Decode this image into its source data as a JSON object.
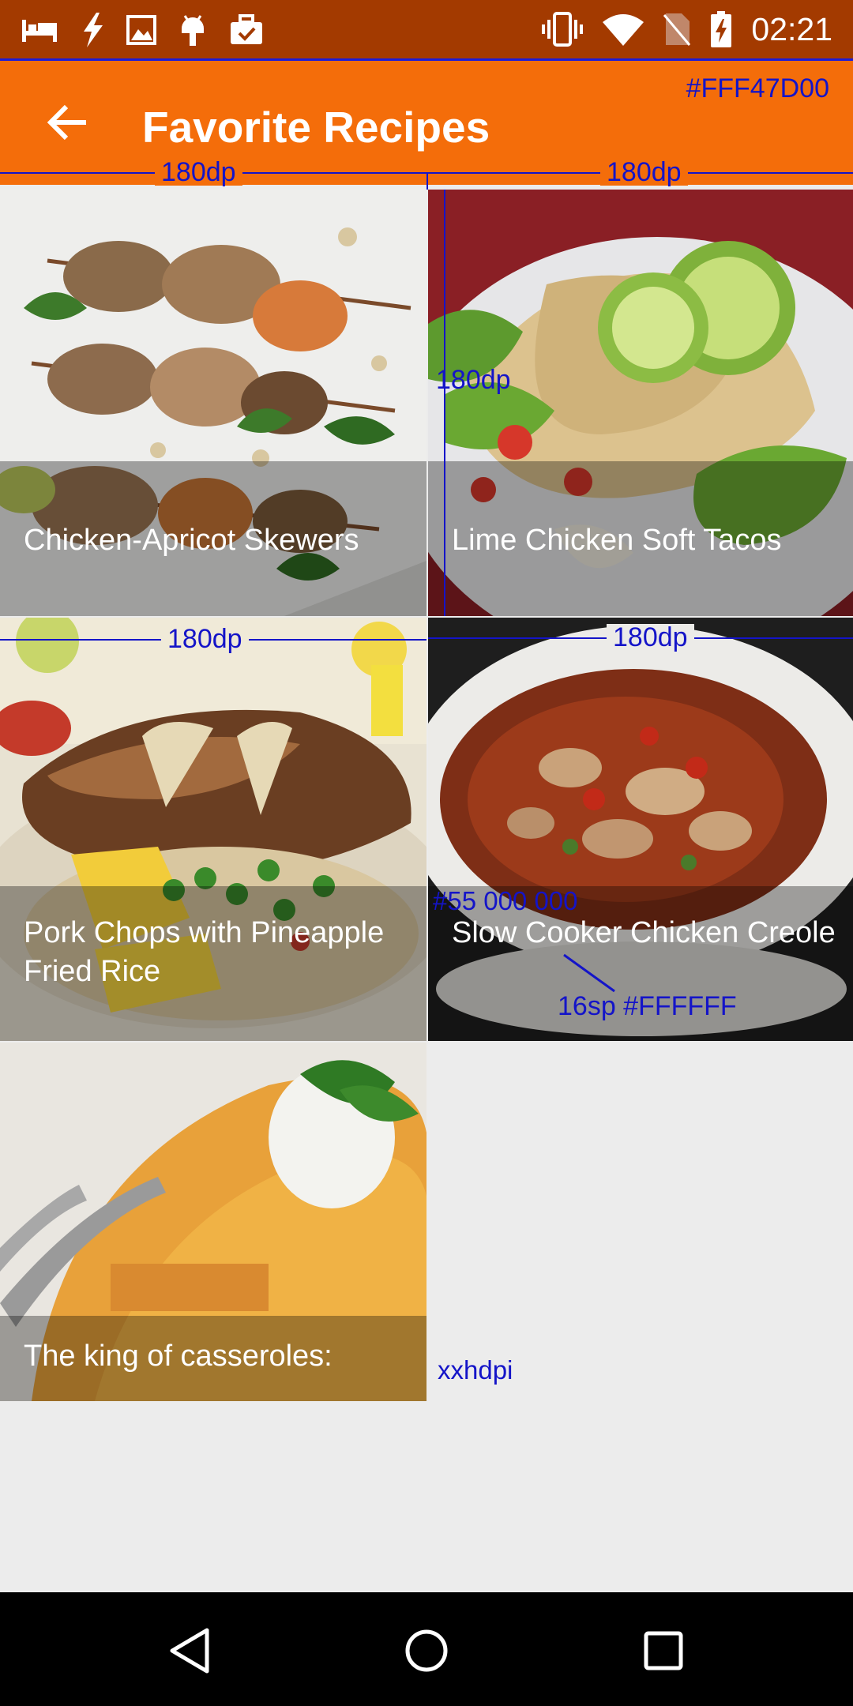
{
  "status_bar": {
    "time": "02:21",
    "left_icons": [
      "sleep-icon",
      "flash-icon",
      "image-icon",
      "android-icon",
      "briefcase-check-icon"
    ],
    "right_icons": [
      "vibrate-icon",
      "wifi-icon",
      "no-sim-icon",
      "battery-charging-icon"
    ]
  },
  "app_bar": {
    "title": "Favorite Recipes",
    "back_icon": "back-arrow-icon",
    "color": "#F46D0A"
  },
  "recipes": [
    {
      "title": "Chicken-Apricot Skewers"
    },
    {
      "title": "Lime Chicken Soft Tacos"
    },
    {
      "title": "Pork Chops with Pineapple Fried Rice"
    },
    {
      "title": "Slow Cooker Chicken Creole"
    },
    {
      "title": "The king of casseroles:"
    }
  ],
  "annotations": {
    "app_bar_color": "#FFF47D00",
    "col1_width": "180dp",
    "col2_width": "180dp",
    "tile_height": "180dp",
    "row2_col1_width": "180dp",
    "row2_col2_width": "180dp",
    "caption_bg": "#55 000 000",
    "caption_text": "16sp #FFFFFF",
    "density": "xxhdpi"
  },
  "nav_bar": {
    "back_icon": "nav-back-icon",
    "home_icon": "nav-home-icon",
    "recents_icon": "nav-recents-icon"
  }
}
